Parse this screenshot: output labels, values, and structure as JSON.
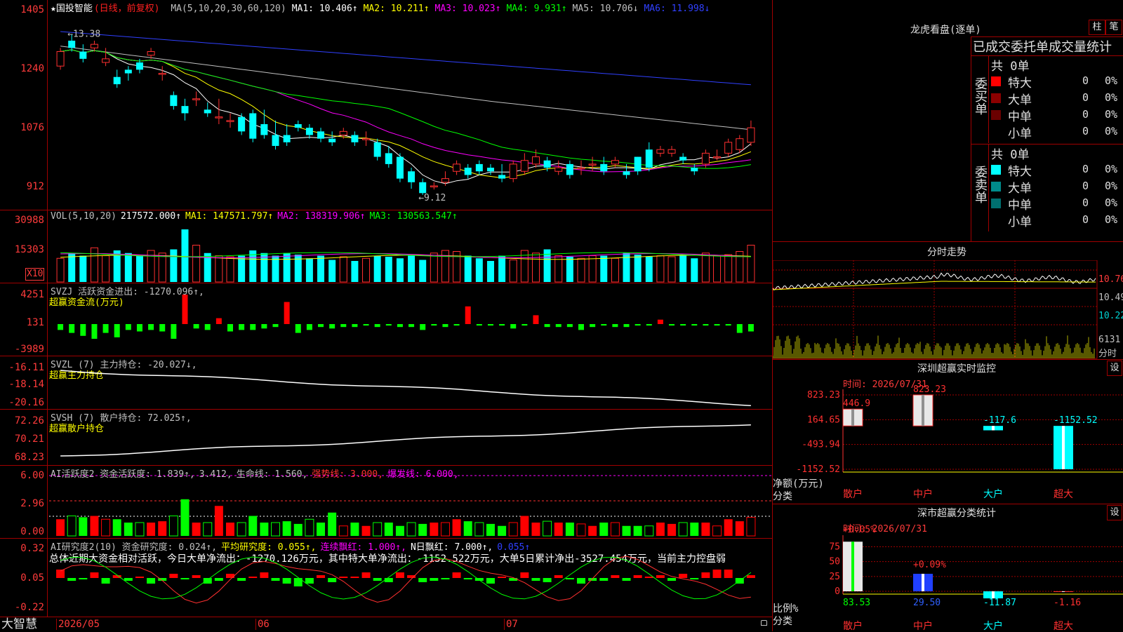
{
  "main": {
    "title": "★国投智能",
    "period": "(日线，前复权)",
    "ma_labels": [
      {
        "text": "MA(5,10,20,30,60,120)",
        "color": "#c0c0c0"
      },
      {
        "text": "MA1: 10.406↑",
        "color": "#ffffff"
      },
      {
        "text": "MA2: 10.211↑",
        "color": "#ffff00"
      },
      {
        "text": "MA3: 10.023↑",
        "color": "#ff00ff"
      },
      {
        "text": "MA4: 9.931↑",
        "color": "#00ff00"
      },
      {
        "text": "MA5: 10.706↓",
        "color": "#c0c0c0"
      },
      {
        "text": "MA6: 11.998↓",
        "color": "#3040ff"
      }
    ],
    "y_ticks": [
      "1405",
      "1240",
      "1076",
      "912"
    ],
    "high_marker": "←13.38",
    "low_marker": "←9.12",
    "candles_open": [
      12.5,
      13.2,
      12.9,
      13.0,
      12.6,
      12.2,
      12.4,
      12.6,
      12.8,
      12.3,
      11.7,
      11.4,
      11.6,
      11.3,
      11.1,
      11.0,
      11.1,
      11.2,
      10.9,
      10.6,
      10.6,
      10.9,
      10.8,
      10.7,
      10.5,
      10.6,
      10.6,
      10.5,
      10.4,
      10.1,
      10.0,
      9.6,
      9.3,
      9.2,
      9.3,
      9.6,
      9.7,
      9.8,
      9.7,
      9.5,
      9.4,
      9.6,
      9.8,
      9.9,
      9.6,
      9.8,
      9.7,
      9.8,
      9.8,
      9.8,
      9.6,
      10.0,
      10.2,
      10.1,
      10.1,
      10.0,
      9.7,
      9.8,
      10.0,
      10.1,
      10.2,
      10.4
    ],
    "candles_close": [
      12.9,
      13.0,
      12.7,
      13.1,
      12.7,
      12.0,
      12.3,
      12.4,
      12.9,
      12.3,
      11.4,
      11.2,
      11.6,
      11.2,
      11.1,
      11.0,
      10.7,
      10.5,
      10.6,
      10.3,
      10.4,
      10.8,
      10.6,
      10.5,
      10.4,
      10.7,
      10.4,
      10.5,
      10.0,
      9.8,
      9.4,
      9.3,
      9.0,
      9.2,
      9.4,
      9.8,
      9.5,
      9.6,
      9.6,
      9.4,
      9.8,
      9.9,
      10.0,
      9.7,
      9.7,
      9.5,
      9.7,
      9.8,
      9.6,
      9.9,
      9.5,
      9.6,
      9.7,
      10.2,
      10.2,
      9.9,
      9.6,
      10.1,
      10.0,
      10.4,
      10.5,
      10.8
    ],
    "candles_high": [
      13.0,
      13.38,
      13.1,
      13.2,
      13.0,
      12.4,
      12.5,
      12.7,
      13.0,
      12.5,
      11.8,
      11.6,
      11.8,
      11.5,
      11.6,
      11.2,
      11.2,
      11.3,
      11.3,
      11.0,
      10.9,
      11.0,
      10.9,
      10.8,
      10.7,
      10.8,
      10.7,
      10.7,
      10.5,
      10.3,
      10.1,
      9.7,
      9.4,
      9.3,
      9.6,
      9.9,
      9.8,
      9.9,
      9.8,
      9.8,
      9.9,
      10.1,
      10.2,
      10.0,
      9.9,
      9.9,
      9.9,
      10.0,
      10.0,
      10.0,
      9.8,
      10.0,
      10.4,
      10.3,
      10.3,
      10.1,
      9.8,
      10.2,
      10.2,
      10.5,
      10.6,
      11.0
    ],
    "candles_low": [
      12.4,
      12.9,
      12.6,
      12.9,
      12.5,
      11.9,
      12.1,
      12.3,
      12.7,
      12.1,
      11.3,
      11.0,
      11.4,
      11.1,
      10.9,
      10.8,
      10.6,
      10.4,
      10.5,
      10.2,
      10.3,
      10.7,
      10.5,
      10.4,
      10.3,
      10.5,
      10.3,
      10.3,
      9.9,
      9.7,
      9.3,
      9.12,
      8.95,
      9.1,
      9.2,
      9.5,
      9.4,
      9.5,
      9.5,
      9.3,
      9.3,
      9.5,
      9.7,
      9.6,
      9.5,
      9.4,
      9.5,
      9.6,
      9.5,
      9.7,
      9.4,
      9.5,
      9.6,
      10.0,
      10.0,
      9.8,
      9.5,
      9.7,
      9.9,
      10.0,
      10.1,
      10.3
    ]
  },
  "vol": {
    "header": [
      {
        "text": "VOL(5,10,20)",
        "color": "#c0c0c0"
      },
      {
        "text": "217572.000↑",
        "color": "#ffffff"
      },
      {
        "text": "MA1: 147571.797↑",
        "color": "#ffff00"
      },
      {
        "text": "MA2: 138319.906↑",
        "color": "#ff00ff"
      },
      {
        "text": "MA3: 130563.547↑",
        "color": "#00ff00"
      }
    ],
    "y_ticks": [
      "30988",
      "15303"
    ],
    "unit": "X10"
  },
  "svzj": {
    "header": [
      {
        "text": "SVZJ  活跃资金进出: -1270.096↑,",
        "color": "#c0c0c0"
      }
    ],
    "subtitle": "超赢资金流(万元)",
    "y_ticks": [
      "4251",
      "131",
      "-3989"
    ]
  },
  "svzl": {
    "header": [
      {
        "text": "SVZL (7) 主力持仓: -20.027↓,",
        "color": "#c0c0c0"
      }
    ],
    "subtitle": "超赢主力持仓",
    "y_ticks": [
      "-16.11",
      "-18.14",
      "-20.16"
    ]
  },
  "svsh": {
    "header": [
      {
        "text": "SVSH (7) 散户持仓: 72.025↑,",
        "color": "#c0c0c0"
      }
    ],
    "subtitle": "超赢散户持仓",
    "y_ticks": [
      "72.26",
      "70.21",
      "68.23"
    ]
  },
  "ai1": {
    "header": [
      {
        "text": "AI活跃度2 资金活跃度: 1.839↑,",
        "color": "#c0c0c0"
      },
      {
        "text": "3.412,",
        "color": "#c0c0c0"
      },
      {
        "text": "生命线: 1.560,",
        "color": "#c0c0c0"
      },
      {
        "text": "强势线: 3.000,",
        "color": "#ff3030"
      },
      {
        "text": "爆发线: 6.000,",
        "color": "#ff00ff"
      }
    ],
    "y_ticks": [
      "6.00",
      "2.96",
      "0.00"
    ]
  },
  "ai2": {
    "header": [
      {
        "text": "AI研究度2(10) 资金研究度: 0.024↑,",
        "color": "#c0c0c0"
      },
      {
        "text": "平均研究度: 0.055↑,",
        "color": "#ffff00"
      },
      {
        "text": "连续飘红: 1.000↑,",
        "color": "#ff00ff"
      },
      {
        "text": "N日飘红: 7.000↑,",
        "color": "#ffffff"
      },
      {
        "text": "0.055↑",
        "color": "#3040ff"
      }
    ],
    "summary": "总体近期大资金相对活跃，今日大单净流出：-1270.126万元，其中特大单净流出：-1152.522万元，大单5日累计净出-3527.454万元，当前主力控盘弱",
    "y_ticks": [
      "0.32",
      "0.05",
      "-0.22"
    ]
  },
  "xaxis": {
    "brand": "大智慧",
    "labels": [
      "2026/05",
      "06",
      "07"
    ]
  },
  "lhb": {
    "title": "龙虎看盘(逐单)",
    "btn1": "柱",
    "btn2": "笔",
    "subtitle": "已成交委托单成交量统计",
    "buy_side": "委买单",
    "sell_side": "委卖单",
    "buy_total": "共 0单",
    "sell_total": "共 0单",
    "buy_rows": [
      {
        "label": "特大",
        "count": "0",
        "pct": "0%",
        "color": "#ff0000"
      },
      {
        "label": "大单",
        "count": "0",
        "pct": "0%",
        "color": "#8b0000"
      },
      {
        "label": "中单",
        "count": "0",
        "pct": "0%",
        "color": "#6a0000"
      },
      {
        "label": "小单",
        "count": "0",
        "pct": "0%",
        "color": "#000000"
      }
    ],
    "sell_rows": [
      {
        "label": "特大",
        "count": "0",
        "pct": "0%",
        "color": "#00ffff"
      },
      {
        "label": "大单",
        "count": "0",
        "pct": "0%",
        "color": "#008b8b"
      },
      {
        "label": "中单",
        "count": "0",
        "pct": "0%",
        "color": "#007070"
      },
      {
        "label": "小单",
        "count": "0",
        "pct": "0%",
        "color": "#000000"
      }
    ]
  },
  "fenshi": {
    "title": "分时走势",
    "y_ticks": [
      "10.76",
      "10.49",
      "10.22"
    ],
    "vol_label": "6131",
    "unit_label": "分时"
  },
  "sz_monitor": {
    "title": "深圳超赢实时监控",
    "btn": "设",
    "time": "时间: 2026/07/31",
    "y_ticks": [
      "823.23",
      "164.65",
      "-493.94",
      "-1152.52"
    ],
    "ylabel": "净额(万元)",
    "xlabel": "分类",
    "categories": [
      "散户",
      "中户",
      "大户",
      "超大"
    ],
    "values": [
      446.9,
      823.23,
      -117.6,
      -1152.52
    ],
    "value_labels": [
      "446.9",
      "823.23",
      "-117.6",
      "-1152.52"
    ]
  },
  "sz_class": {
    "title": "深市超赢分类统计",
    "btn": "设",
    "time": "时间: 2026/07/31",
    "y_ticks": [
      "75",
      "50",
      "25",
      "0"
    ],
    "ylabel": "比例%",
    "xlabel": "分类",
    "categories": [
      "散户",
      "中户",
      "大户",
      "超大"
    ],
    "top_labels": [
      "+0.05%",
      "+0.09%",
      "",
      ""
    ],
    "values": [
      83.53,
      29.5,
      -11.87,
      -1.16
    ],
    "value_labels": [
      "83.53",
      "29.50",
      "-11.87",
      "-1.16"
    ]
  }
}
